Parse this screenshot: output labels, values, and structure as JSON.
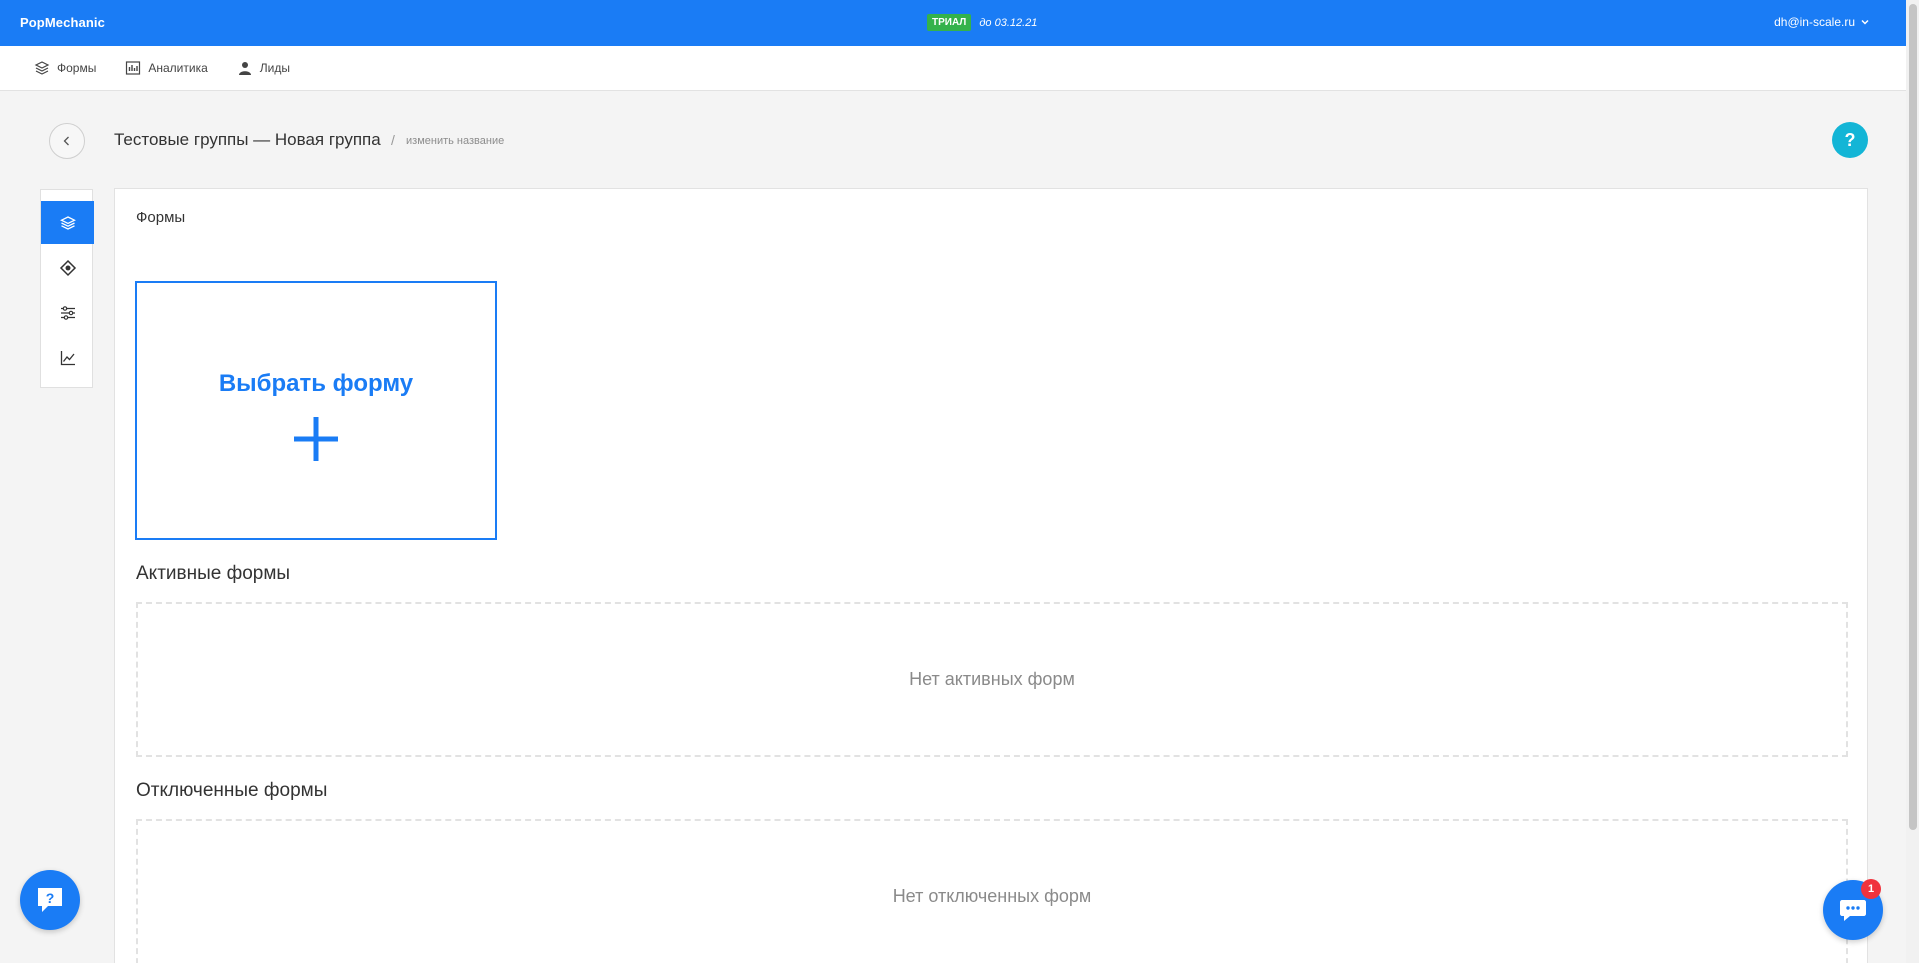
{
  "app": {
    "brand": "PopMechanic"
  },
  "trial": {
    "badge": "ТРИАЛ",
    "until": "до 03.12.21"
  },
  "user": {
    "email": "dh@in-scale.ru"
  },
  "nav": {
    "items": [
      {
        "label": "Формы",
        "icon": "layers-icon"
      },
      {
        "label": "Аналитика",
        "icon": "analytics-icon"
      },
      {
        "label": "Лиды",
        "icon": "leads-icon"
      }
    ]
  },
  "header": {
    "title": "Тестовые группы — Новая группа",
    "separator": "/",
    "rename": "изменить название",
    "help": "?"
  },
  "side_tabs": [
    {
      "icon": "layers-icon",
      "active": true
    },
    {
      "icon": "target-icon",
      "active": false
    },
    {
      "icon": "settings-sliders-icon",
      "active": false
    },
    {
      "icon": "line-chart-icon",
      "active": false
    }
  ],
  "panel": {
    "title": "Формы",
    "choose_label": "Выбрать форму",
    "active_heading": "Активные формы",
    "active_empty": "Нет активных форм",
    "disabled_heading": "Отключенные формы",
    "disabled_empty": "Нет отключенных форм"
  },
  "chat": {
    "badge_count": "1"
  },
  "colors": {
    "primary": "#1a7cf5",
    "trial": "#34b24b",
    "help": "#13b5d6",
    "badge": "#f0323c"
  }
}
